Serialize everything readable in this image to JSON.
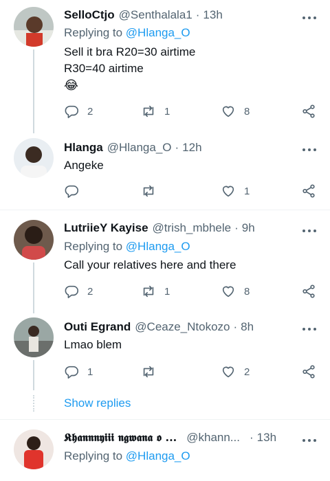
{
  "tweets": [
    {
      "name": "SelloCtjo",
      "handle": "@Senthalala1",
      "time": "13h",
      "replying_label": "Replying to",
      "replying_to": "@Hlanga_O",
      "text": "Sell it bra R20=30 airtime\nR30=40 airtime",
      "emoji": "😂",
      "replies": "2",
      "retweets": "1",
      "likes": "8"
    },
    {
      "name": "Hlanga",
      "handle": "@Hlanga_O",
      "time": "12h",
      "text": "Angeke",
      "replies": "",
      "retweets": "",
      "likes": "1"
    },
    {
      "name": "LutriieY Kayise",
      "handle": "@trish_mbhele",
      "time": "9h",
      "replying_label": "Replying to",
      "replying_to": "@Hlanga_O",
      "text": "Call your relatives here and there",
      "replies": "2",
      "retweets": "1",
      "likes": "8"
    },
    {
      "name": "Outi Egrand",
      "handle": "@Ceaze_Ntokozo",
      "time": "8h",
      "text": "Lmao blem",
      "replies": "1",
      "retweets": "",
      "likes": "2"
    },
    {
      "name": "𝕶𝖍𝖆𝖓𝖓𝖓𝖞𝖎𝖎𝖎 𝖓𝖌𝖜𝖆𝖓𝖆 𝖔 ...",
      "handle": "@khann...",
      "time": "13h",
      "replying_label": "Replying to",
      "replying_to": "@Hlanga_O"
    }
  ],
  "show_replies": "Show replies",
  "dot": "·",
  "colors": {
    "accent": "#1d9bf0",
    "muted": "#536471",
    "text": "#0f1419",
    "line": "#cfd9de"
  },
  "icons": [
    "reply-icon",
    "retweet-icon",
    "like-icon",
    "share-icon",
    "more-icon"
  ]
}
